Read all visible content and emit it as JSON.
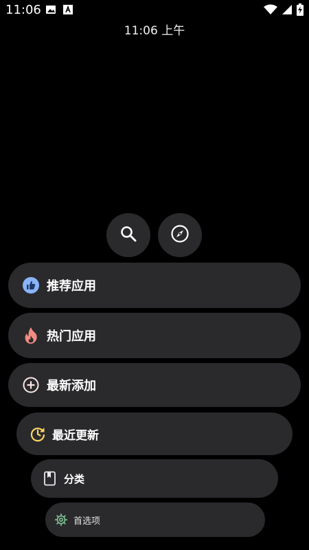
{
  "status_bar": {
    "time": "11:06",
    "icons": [
      "image-icon",
      "font-icon",
      "wifi-icon",
      "signal-icon",
      "battery-charging-icon"
    ]
  },
  "clock": {
    "text": "11:06 上午"
  },
  "quick_actions": {
    "search_icon": "search-icon",
    "explore_icon": "compass-icon"
  },
  "menu": {
    "items": [
      {
        "label": "推荐应用",
        "icon": "thumbs-up-icon",
        "color": "#8ab4f8"
      },
      {
        "label": "热门应用",
        "icon": "fire-icon",
        "color": "#f28b82"
      },
      {
        "label": "最新添加",
        "icon": "add-circle-icon",
        "color": "#fce8e6"
      },
      {
        "label": "最近更新",
        "icon": "update-icon",
        "color": "#fdd663"
      },
      {
        "label": "分类",
        "icon": "book-icon",
        "color": "#e8eaed"
      },
      {
        "label": "首选项",
        "icon": "gear-icon",
        "color": "#81c995"
      }
    ]
  },
  "colors": {
    "background": "#000000",
    "pill": "#2a2a2d",
    "text": "#ffffff"
  }
}
